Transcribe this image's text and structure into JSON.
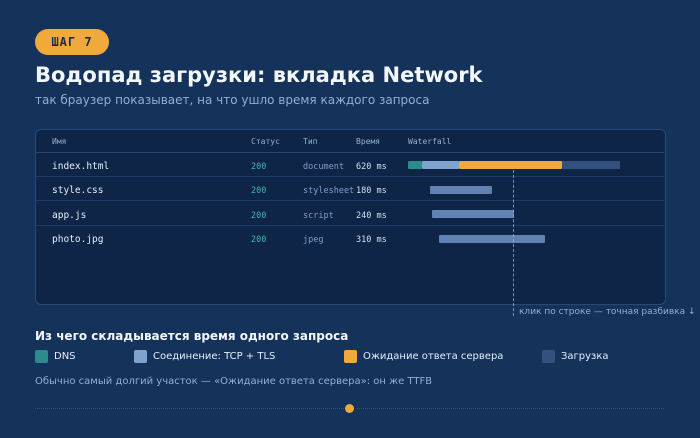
{
  "step_badge": "ШАГ 7",
  "title": "Водопад загрузки: вкладка Network",
  "subtitle": "так браузер показывает, на что ушло время каждого запроса",
  "table": {
    "headers": {
      "name": "Имя",
      "status": "Статус",
      "type": "Тип",
      "time": "Время",
      "waterfall": "Waterfall"
    },
    "rows": [
      {
        "name": "index.html",
        "status": "200",
        "type": "document",
        "time": "620 ms",
        "waterfall": [
          {
            "phase": "dns",
            "start": 0,
            "end": 40
          },
          {
            "phase": "connect",
            "start": 40,
            "end": 150
          },
          {
            "phase": "wait",
            "start": 150,
            "end": 450
          },
          {
            "phase": "download",
            "start": 450,
            "end": 620
          }
        ]
      },
      {
        "name": "style.css",
        "status": "200",
        "type": "stylesheet",
        "time": "180 ms",
        "waterfall": [
          {
            "phase": "request",
            "start": 65,
            "end": 245
          }
        ]
      },
      {
        "name": "app.js",
        "status": "200",
        "type": "script",
        "time": "240 ms",
        "waterfall": [
          {
            "phase": "request",
            "start": 70,
            "end": 310
          }
        ]
      },
      {
        "name": "photo.jpg",
        "status": "200",
        "type": "jpeg",
        "time": "310 ms",
        "waterfall": [
          {
            "phase": "request",
            "start": 90,
            "end": 400
          }
        ]
      }
    ],
    "marker_ms": 310
  },
  "hint": "клик по строке — точная разбивка ↓",
  "legend": {
    "title": "Из чего складывается время одного запроса",
    "items": [
      {
        "label": "DNS",
        "color": "#2e8b8b"
      },
      {
        "label": "Соединение: TCP + TLS",
        "color": "#7fa3cf"
      },
      {
        "label": "Ожидание ответа сервера",
        "color": "#f2a93b"
      },
      {
        "label": "Загрузка",
        "color": "#34507e"
      }
    ]
  },
  "phase_colors": {
    "dns": "#2e8b8b",
    "connect": "#7fa3cf",
    "wait": "#f2a93b",
    "download": "#34507e",
    "request": "#5f82b3"
  },
  "footnote": "Обычно самый долгий участок — «Ожидание ответа сервера»: он же TTFB"
}
